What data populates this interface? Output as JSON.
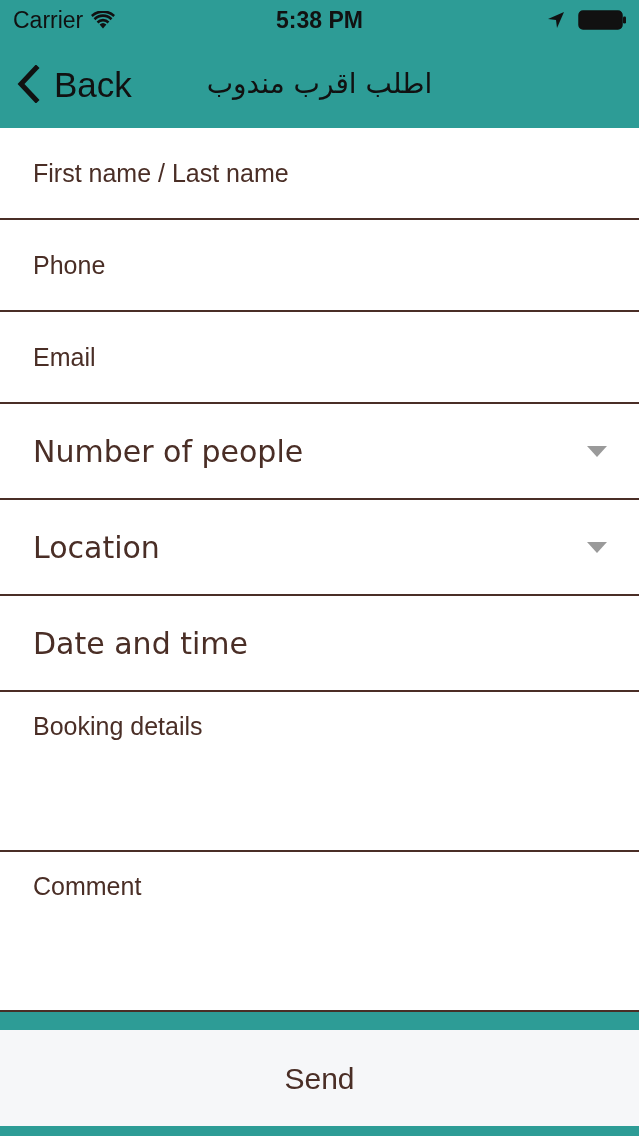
{
  "status_bar": {
    "carrier": "Carrier",
    "time": "5:38 PM"
  },
  "nav_bar": {
    "back": "Back",
    "title": "اطلب اقرب مندوب"
  },
  "form": {
    "fields": [
      {
        "kind": "text",
        "placeholder": "First name / Last name"
      },
      {
        "kind": "text",
        "placeholder": "Phone"
      },
      {
        "kind": "text",
        "placeholder": "Email"
      },
      {
        "kind": "select",
        "placeholder": "Number of people"
      },
      {
        "kind": "select",
        "placeholder": "Location"
      },
      {
        "kind": "datetime",
        "placeholder": "Date and time"
      },
      {
        "kind": "textarea",
        "placeholder": "Booking details"
      },
      {
        "kind": "textarea",
        "placeholder": "Comment"
      }
    ]
  },
  "submit": {
    "label": "Send"
  }
}
